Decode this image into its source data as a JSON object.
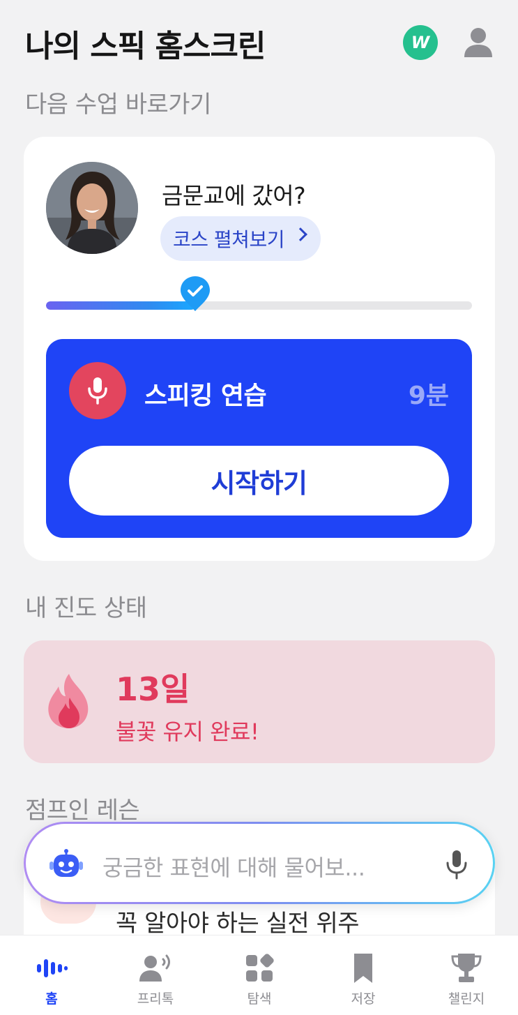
{
  "header": {
    "title": "나의 스픽 홈스크린",
    "wallet_symbol": "W"
  },
  "next_lesson": {
    "section_label": "다음 수업 바로가기",
    "lesson_title": "금문교에 갔어?",
    "course_button": "코스 펼쳐보기",
    "progress_fraction": 0.35,
    "practice": {
      "title": "스피킹 연습",
      "duration": "9분",
      "start_label": "시작하기"
    }
  },
  "progress": {
    "section_label": "내 진도 상태",
    "streak_days": "13일",
    "streak_message": "불꽃 유지 완료!"
  },
  "jump_in": {
    "section_label": "점프인 레슨",
    "item_title": "꼭 알아야 하는 실전 위주"
  },
  "ai_search": {
    "placeholder": "궁금한 표현에 대해 물어보..."
  },
  "bottom_nav": {
    "items": [
      {
        "label": "홈",
        "icon": "waveform-icon",
        "active": true
      },
      {
        "label": "프리톡",
        "icon": "person-speaking-icon",
        "active": false
      },
      {
        "label": "탐색",
        "icon": "explore-grid-icon",
        "active": false
      },
      {
        "label": "저장",
        "icon": "bookmark-icon",
        "active": false
      },
      {
        "label": "챌린지",
        "icon": "trophy-icon",
        "active": false
      }
    ]
  },
  "colors": {
    "accent_blue": "#1f44f6",
    "streak_red": "#e03a5c",
    "wallet_green": "#25c08e",
    "mic_red": "#e3455e"
  }
}
